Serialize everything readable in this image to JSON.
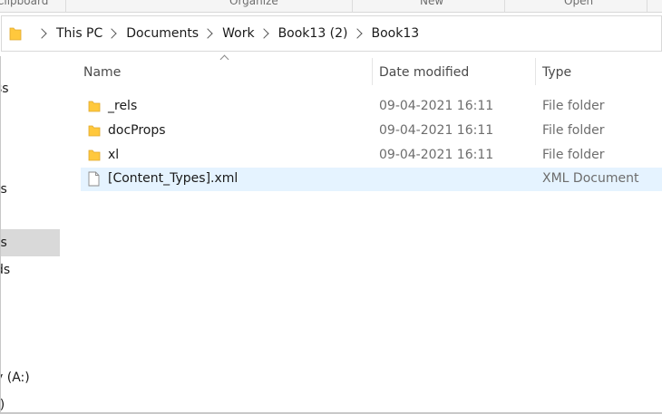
{
  "ribbon": {
    "groups": [
      "Clipboard",
      "Organize",
      "New",
      "Open"
    ]
  },
  "address": {
    "crumbs": [
      "This PC",
      "Documents",
      "Work",
      "Book13 (2)",
      "Book13"
    ]
  },
  "nav": {
    "items": [
      "ss",
      "ts",
      "ts",
      "ds",
      "y (A:)",
      ":)"
    ]
  },
  "columns": {
    "name": "Name",
    "date": "Date modified",
    "type": "Type"
  },
  "files": [
    {
      "name": "_rels",
      "date": "09-04-2021 16:11",
      "type": "File folder",
      "icon": "folder-icon"
    },
    {
      "name": "docProps",
      "date": "09-04-2021 16:11",
      "type": "File folder",
      "icon": "folder-icon"
    },
    {
      "name": "xl",
      "date": "09-04-2021 16:11",
      "type": "File folder",
      "icon": "folder-icon"
    },
    {
      "name": "[Content_Types].xml",
      "date": "",
      "type": "XML Document",
      "icon": "file-icon"
    }
  ],
  "colors": {
    "folder": "#ffc83d",
    "selection": "#e5f3ff",
    "nav_selected": "#d9d9d9"
  }
}
